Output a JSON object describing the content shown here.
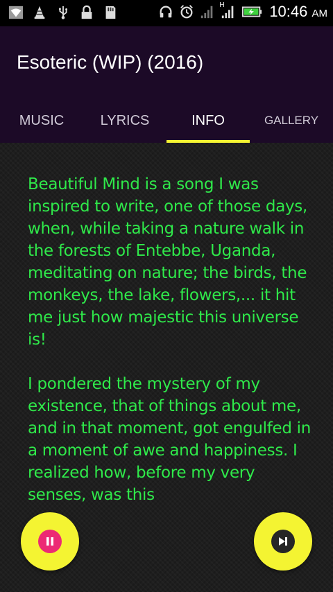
{
  "status_bar": {
    "left_icons": [
      "wifi-icon",
      "vlc-icon",
      "usb-icon",
      "lock-icon",
      "sd-card-icon"
    ],
    "right_icons": [
      "headphones-icon",
      "alarm-icon",
      "signal-weak-icon",
      "signal-h-icon",
      "battery-charging-icon"
    ],
    "network_label": "H",
    "time": "10:46",
    "ampm": "AM"
  },
  "app_bar": {
    "title": "Esoteric (WIP) (2016)"
  },
  "tabs": [
    {
      "label": "MUSIC",
      "active": false
    },
    {
      "label": "LYRICS",
      "active": false
    },
    {
      "label": "INFO",
      "active": true
    },
    {
      "label": "GALLERY",
      "active": false
    }
  ],
  "info": {
    "paragraphs": [
      "Beautiful Mind is a song I was inspired to write, one of those days, when, while taking a nature walk in the forests of Entebbe, Uganda, meditating on nature; the birds, the monkeys, the lake, flowers,... it hit me just how majestic this universe is!",
      "I pondered the mystery of my existence, that of things about me, and in that moment, got engulfed in a moment of awe and happiness. I realized how, before my very senses, was this"
    ]
  },
  "controls": {
    "pause_icon": "pause-icon",
    "next_icon": "skip-next-icon"
  },
  "colors": {
    "app_bar": "#1c0a27",
    "accent": "#f4f432",
    "text": "#2fe94a",
    "pause_inner": "#ec2a74"
  }
}
